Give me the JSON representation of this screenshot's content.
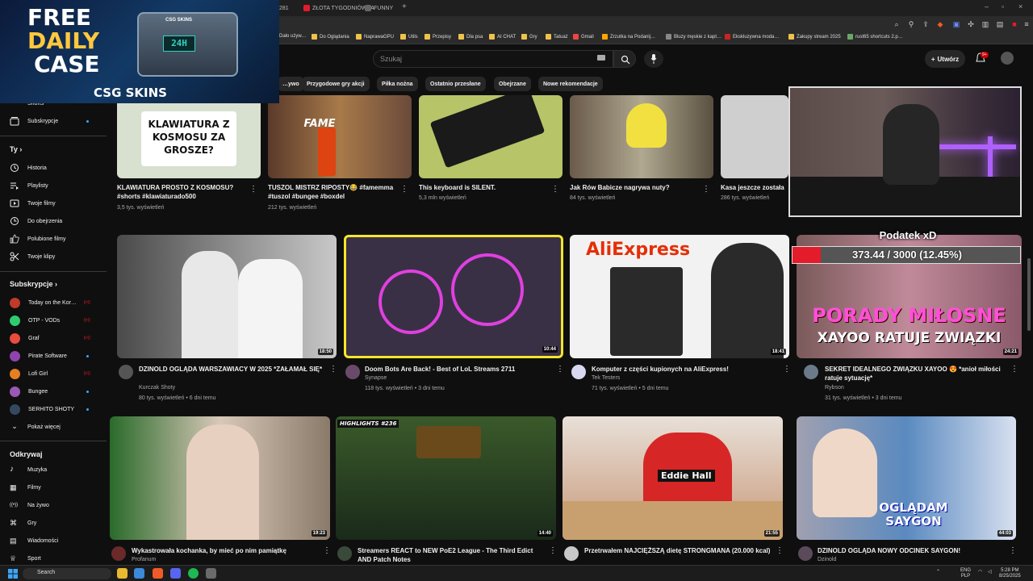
{
  "browser": {
    "tabs": [
      {
        "label": "281"
      },
      {
        "label": "ZŁOTA TYGODNIÓWKA"
      },
      {
        "label": "FUNNY"
      }
    ],
    "new_tab": "+",
    "bookmarks": [
      "Dało używ…",
      "Do Oglądania",
      "NaprawaGPU",
      "Utils",
      "Przepisy",
      "Dla psa",
      "AI CHAT",
      "Gry",
      "Tatuaż",
      "Gmail",
      "Zrzutka na Podanij…",
      "Bluzy męskie z kapt…",
      "Ekskluzywna moda…",
      "Zakupy stream 2025",
      "rust65 shortcuts 2.p…"
    ]
  },
  "ad": {
    "line1": "FREE",
    "line2": "DAILY",
    "line3": "CASE",
    "chest_label": "CSG SKINS",
    "timer": "24H",
    "brand": "CSG SKINS"
  },
  "header": {
    "search_placeholder": "Szukaj",
    "create_label": "Utwórz",
    "notifications": "9+"
  },
  "chips": [
    "…ywo",
    "Przygodowe gry akcji",
    "Piłka nożna",
    "Ostatnio przesłane",
    "Obejrzane",
    "Nowe rekomendacje"
  ],
  "sidebar": {
    "top": [
      {
        "label": "Shorts",
        "icon": "shorts-icon"
      },
      {
        "label": "Subskrypcje",
        "icon": "subscriptions-icon"
      }
    ],
    "you_heading": "Ty",
    "you": [
      {
        "label": "Historia",
        "icon": "history-icon"
      },
      {
        "label": "Playlisty",
        "icon": "playlist-icon"
      },
      {
        "label": "Twoje filmy",
        "icon": "your-videos-icon"
      },
      {
        "label": "Do obejrzenia",
        "icon": "watch-later-icon"
      },
      {
        "label": "Polubione filmy",
        "icon": "like-icon"
      },
      {
        "label": "Twoje klipy",
        "icon": "scissors-icon"
      }
    ],
    "subs_heading": "Subskrypcje",
    "subs": [
      {
        "label": "Today on the Kor…",
        "color": "#c0392b",
        "live": true
      },
      {
        "label": "OTP - VODs",
        "color": "#2ecc71",
        "live": true
      },
      {
        "label": "Graf",
        "color": "#e74c3c",
        "live": true
      },
      {
        "label": "Pirate Software",
        "color": "#8e44ad",
        "live": false
      },
      {
        "label": "Lofi Girl",
        "color": "#e67e22",
        "live": true
      },
      {
        "label": "Bungee",
        "color": "#9b59b6",
        "live": false
      },
      {
        "label": "SERHITO SHOTY",
        "color": "#34495e",
        "live": false
      }
    ],
    "show_more": "Pokaż więcej",
    "explore_heading": "Odkrywaj",
    "explore": [
      {
        "label": "Muzyka",
        "icon": "music-icon"
      },
      {
        "label": "Filmy",
        "icon": "film-icon"
      },
      {
        "label": "Na żywo",
        "icon": "live-icon"
      },
      {
        "label": "Gry",
        "icon": "gamepad-icon"
      },
      {
        "label": "Wiadomości",
        "icon": "news-icon"
      },
      {
        "label": "Sport",
        "icon": "trophy-icon"
      }
    ]
  },
  "overlay": {
    "tax_title": "Podatek xD",
    "tax_text": "373.44 / 3000 (12.45%)",
    "tax_fraction": 0.1245
  },
  "shorts_row": [
    {
      "title": "KLAWIATURA PROSTO Z KOSMOSU? #shorts #klawiaturado500",
      "views": "3,5 tys. wyświetleń",
      "thumb_text": "KLAWIATURA Z KOSMOSU ZA GROSZE?",
      "color": "#d8e0d0"
    },
    {
      "title": "TUSZOL MISTRZ RIPOSTY😂 #famemma #tuszol #bungee #boxdel",
      "views": "212 tys. wyświetleń",
      "thumb_text": "FAME",
      "color": "#7a5a3a"
    },
    {
      "title": "This keyboard is SILENT.",
      "views": "5,3 mln wyświetleń",
      "thumb_text": "",
      "color": "#b8c468"
    },
    {
      "title": "Jak Rów Babicze nagrywa nuty?",
      "views": "84 tys. wyświetleń",
      "thumb_text": "",
      "color": "#9a8a6a"
    },
    {
      "title": "Kasa jeszcze została",
      "views": "286 tys. wyświetleń",
      "thumb_text": "",
      "color": "#cfcfcf"
    }
  ],
  "row2": [
    {
      "title": "DZINOLD OGLĄDA WARSZAWIACY W 2025 *ZAŁAMAŁ SIĘ*",
      "channel": "Kurczak Shoty",
      "meta": "80 tys. wyświetleń • 6 dni temu",
      "duration": "18:50",
      "color": "#6a6a6a"
    },
    {
      "title": "Doom Bots Are Back! - Best of LoL Streams 2711",
      "channel": "Synapse",
      "meta": "118 tys. wyświetleń • 3 dni temu",
      "duration": "10:44",
      "color": "#3a3046"
    },
    {
      "title": "Komputer z części kupionych na AliExpress!",
      "channel": "Tek Testers",
      "meta": "71 tys. wyświetleń • 5 dni temu",
      "duration": "18:41",
      "color": "#f2f2f2",
      "thumb_text": "AliExpress"
    },
    {
      "title": "SEKRET IDEALNEGO ZWIĄZKU XAYOO 😍 *anioł miłości ratuje sytuację*",
      "channel": "Rybson",
      "meta": "31 tys. wyświetleń • 3 dni temu",
      "duration": "24:21",
      "color": "#c07a8a",
      "thumb_text": "PORADY MIŁOSNE",
      "thumb_text2": "XAYOO RATUJE ZWIĄZKI"
    }
  ],
  "row3": [
    {
      "title": "Wykastrowała kochanka, by mieć po nim pamiątkę",
      "channel": "Profanum",
      "duration": "19:23",
      "color": "#8a7a6a"
    },
    {
      "title": "Streamers REACT to NEW PoE2 League - The Third Edict AND Patch Notes",
      "channel": "",
      "duration": "14:40",
      "color": "#2a3a2a",
      "thumb_text": "HIGHLIGHTS #236"
    },
    {
      "title": "Przetrwałem NAJCIĘŻSZĄ dietę STRONGMANA (20.000 kcal)",
      "channel": "",
      "duration": "21:55",
      "color": "#c8b8a8",
      "thumb_text": "Eddie Hall"
    },
    {
      "title": "DZINOLD OGLĄDA NOWY ODCINEK SAYGON!",
      "channel": "Dzinold",
      "duration": "44:03",
      "color": "#a0b8d0",
      "thumb_text": "OGLĄDAM SAYGON"
    }
  ],
  "taskbar": {
    "search": "Search",
    "lang": "ENG",
    "lang2": "PLP",
    "time": "5:28 PM",
    "date": "8/25/2025"
  }
}
